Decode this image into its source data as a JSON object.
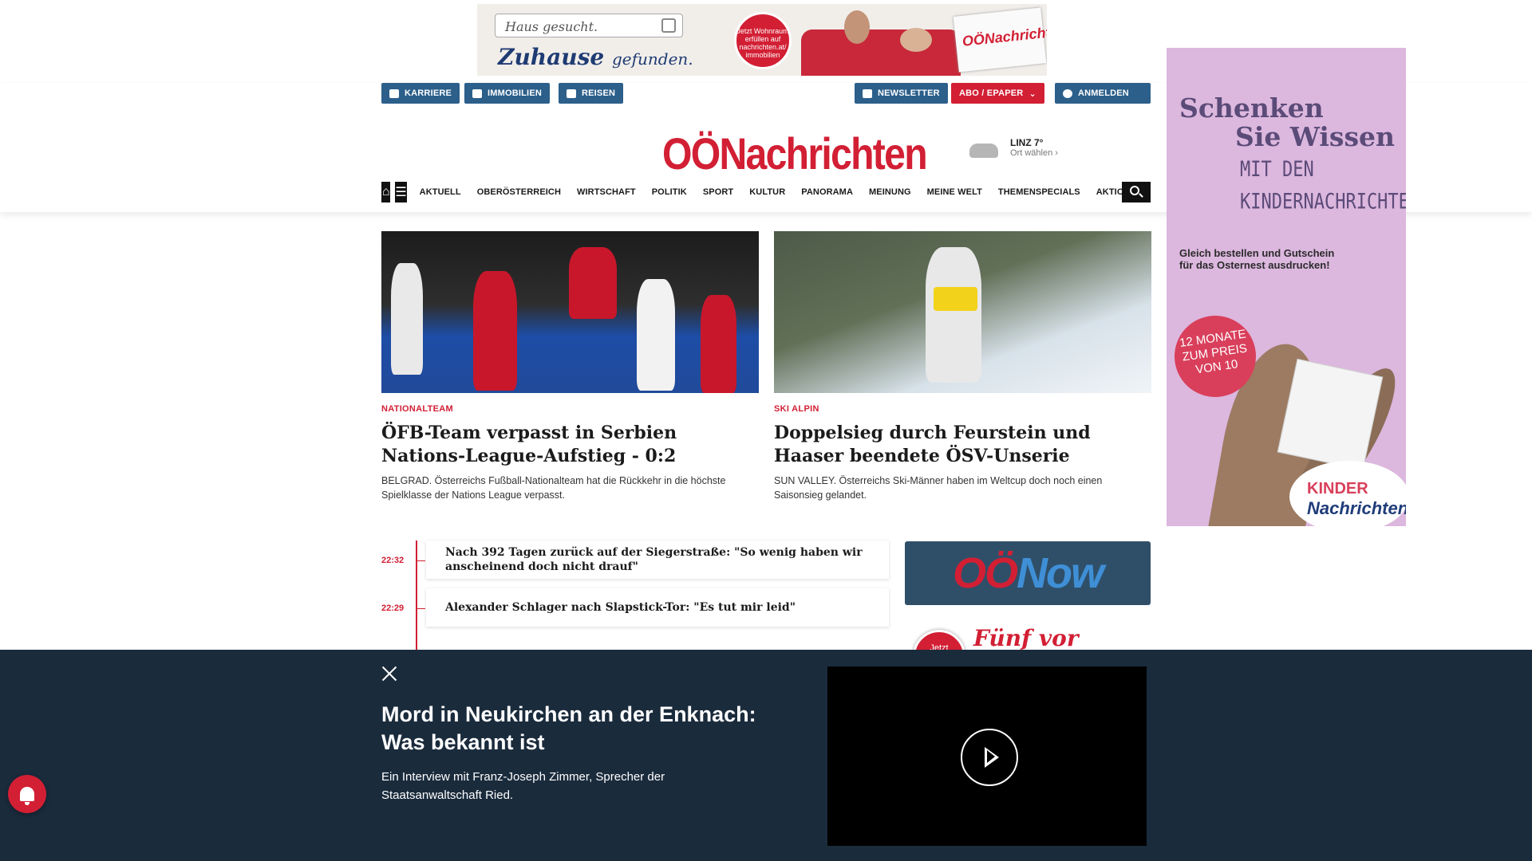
{
  "top_ad": {
    "search_text": "Haus gesucht.",
    "slogan_main": "Zuhause",
    "slogan_rest": "gefunden.",
    "badge_text": "Jetzt Wohnraum erfüllen auf nachrichten.at/ immobilien",
    "paper_text": "OÖNachrichten"
  },
  "header": {
    "buttons": {
      "karriere": "KARRIERE",
      "immobilien": "IMMOBILIEN",
      "reisen": "REISEN",
      "newsletter": "NEWSLETTER",
      "abo": "ABO / EPAPER",
      "anmelden": "ANMELDEN"
    },
    "logo": "OÖNachrichten",
    "weather": {
      "city": "LINZ 7°",
      "select": "Ort wählen"
    },
    "nav": [
      "AKTUELL",
      "OBERÖSTERREICH",
      "WIRTSCHAFT",
      "POLITIK",
      "SPORT",
      "KULTUR",
      "PANORAMA",
      "MEINUNG",
      "MEINE WELT",
      "THEMENSPECIALS",
      "AKTIONEN"
    ]
  },
  "side_ad": {
    "title_1": "Schenken",
    "title_2": "Sie Wissen",
    "subtitle_1": "MIT DEN",
    "subtitle_2": "KINDERNACHRICHTEN",
    "cta_1": "Gleich bestellen und Gutschein",
    "cta_2": "für das Osternest ausdrucken!",
    "offer": "12 MONATE ZUM PREIS VON 10",
    "logo_1": "KINDER",
    "logo_2": "Nachrichten"
  },
  "articles": [
    {
      "kicker": "NATIONALTEAM",
      "headline": "ÖFB-Team verpasst in Serbien Nations-League-Aufstieg - 0:2",
      "teaser": "BELGRAD. Österreichs Fußball-Nationalteam hat die Rückkehr in die höchste Spielklasse der Nations League verpasst."
    },
    {
      "kicker": "SKI ALPIN",
      "headline": "Doppelsieg durch Feurstein und Haaser beendete ÖSV-Unserie",
      "teaser": "SUN VALLEY. Österreichs Ski-Männer haben im Weltcup doch noch einen Saisonsieg gelandet."
    }
  ],
  "ticker": [
    {
      "time": "22:32",
      "text": "Nach 392 Tagen zurück auf der Siegerstraße: \"So wenig haben wir anscheinend doch nicht drauf\""
    },
    {
      "time": "22:29",
      "text": "Alexander Schlager nach Slapstick-Tor: \"Es tut mir leid\""
    }
  ],
  "oenow": {
    "o": "OÖ",
    "n": "Now"
  },
  "fuenf": {
    "badge": "Jetzt",
    "title": "Fünf vor neun."
  },
  "overlay": {
    "title": "Mord in Neukirchen an der Enknach: Was bekannt ist",
    "text": "Ein Interview mit Franz-Joseph Zimmer, Sprecher der Staatsanwaltschaft Ried."
  },
  "colors": {
    "brand": "#d21f34",
    "button_blue": "#2c5f8a",
    "overlay": "#1a2b3c"
  }
}
